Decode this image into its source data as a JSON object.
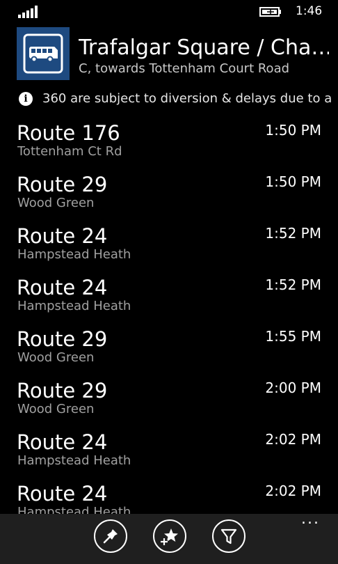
{
  "status": {
    "time": "1:46"
  },
  "header": {
    "stop_name": "Trafalgar Square / Cha…",
    "direction": "C, towards Tottenham Court Road"
  },
  "notice": {
    "icon": "info-icon",
    "text": "360 are subject to diversion & delays due to a"
  },
  "arrivals": [
    {
      "route": "Route 176",
      "destination": "Tottenham Ct Rd",
      "time": "1:50 PM"
    },
    {
      "route": "Route 29",
      "destination": "Wood Green",
      "time": "1:50 PM"
    },
    {
      "route": "Route 24",
      "destination": "Hampstead Heath",
      "time": "1:52 PM"
    },
    {
      "route": "Route 24",
      "destination": "Hampstead Heath",
      "time": "1:52 PM"
    },
    {
      "route": "Route 29",
      "destination": "Wood Green",
      "time": "1:55 PM"
    },
    {
      "route": "Route 29",
      "destination": "Wood Green",
      "time": "2:00 PM"
    },
    {
      "route": "Route 24",
      "destination": "Hampstead Heath",
      "time": "2:02 PM"
    },
    {
      "route": "Route 24",
      "destination": "Hampstead Heath",
      "time": "2:02 PM"
    }
  ],
  "appbar": {
    "buttons": [
      {
        "icon": "pin-icon"
      },
      {
        "icon": "add-favorite-icon"
      },
      {
        "icon": "filter-icon"
      }
    ],
    "more": "..."
  },
  "colors": {
    "tile": "#1e4a80",
    "background": "#000000",
    "appbar": "#1f1f1f"
  }
}
